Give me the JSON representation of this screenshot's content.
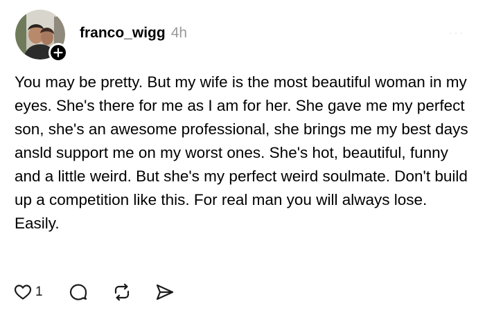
{
  "post": {
    "username": "franco_wigg",
    "timestamp": "4h",
    "body": "You may be pretty. But my wife is the most beautiful woman in my eyes. She's there for me as I am for her. She gave me my perfect son, she's an awesome professional, she brings me my best days ansld support me on my worst ones. She's hot, beautiful, funny and a little weird. But she's my perfect weird soulmate. Don't build up a competition like this. For real man you will always lose. Easily.",
    "like_count": "1"
  },
  "icons": {
    "follow": "plus-icon",
    "more": "more-dots-icon",
    "like": "heart-icon",
    "reply": "comment-icon",
    "repost": "repost-icon",
    "share": "send-icon"
  },
  "colors": {
    "text": "#000000",
    "timestamp": "#9a9a9a",
    "background": "#ffffff"
  }
}
